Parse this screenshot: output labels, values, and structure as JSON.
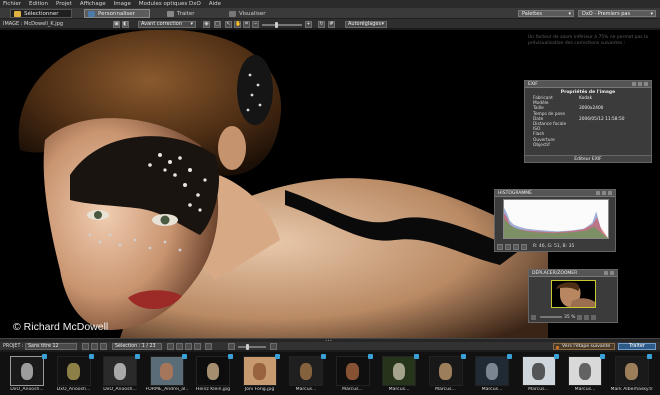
{
  "menu": [
    "Fichier",
    "Edition",
    "Projet",
    "Affichage",
    "Image",
    "Modules optiques DxO",
    "Aide"
  ],
  "workflow_tabs": [
    {
      "label": "Sélectionner",
      "active": false
    },
    {
      "label": "Personnaliser",
      "active": true
    },
    {
      "label": "Traiter",
      "active": false
    },
    {
      "label": "Visualiser",
      "active": false
    }
  ],
  "header": {
    "palette_label": "Palettes",
    "preset_label": "DxO - Premiers pas"
  },
  "image_toolbar": {
    "filename": "IMAGE : McDowell_K.jpg",
    "compare_label": "Avant correction",
    "auto_label": "Autoréglages"
  },
  "viewer": {
    "credit": "© Richard McDowell",
    "faded_note": "Un facteur de zoom inférieur à 75% ne permet pas la prévisualisation des corrections suivantes :"
  },
  "exif": {
    "title": "EXIF",
    "group": "Propriétés de l'image",
    "rows": [
      {
        "k": "Fabricant",
        "v": "Kodak"
      },
      {
        "k": "Modèle",
        "v": ""
      },
      {
        "k": "Taille",
        "v": "3000x2400"
      },
      {
        "k": "Temps de pose",
        "v": ""
      },
      {
        "k": "Date",
        "v": "2006/05/12 11:58:50"
      },
      {
        "k": "Distance focale",
        "v": ""
      },
      {
        "k": "ISO",
        "v": ""
      },
      {
        "k": "Flash",
        "v": ""
      },
      {
        "k": "Ouverture",
        "v": ""
      },
      {
        "k": "Objectif",
        "v": ""
      }
    ],
    "footer": "Editeur EXIF"
  },
  "histogram": {
    "title": "HISTOGRAMME",
    "readout": "R: 46, G: 51, B: 35"
  },
  "navigator": {
    "title": "DÉPLACER/ZOOMER",
    "zoom": "35 %"
  },
  "project_bar": {
    "project_label": "PROJET :",
    "project_name": "Sans titre 12",
    "selection": "Sélection : 1 / 23",
    "next_image": "Vers l'étape suivante",
    "process": "Traiter"
  },
  "divider_grip": "•••",
  "filmstrip": [
    {
      "caption": "DxO_Anoosh...",
      "tone": "#1a1a1a",
      "accent": "#c9c9c9"
    },
    {
      "caption": "DxO_Anoosh...",
      "tone": "#121212",
      "accent": "#b7a55a"
    },
    {
      "caption": "DxO_Anoosh...",
      "tone": "#2a2a2a",
      "accent": "#d4d4d4"
    },
    {
      "caption": "FORME_Andrei_al...",
      "tone": "#5a6c78",
      "accent": "#c07a50"
    },
    {
      "caption": "Heinz Klein.jpg",
      "tone": "#0d0d0d",
      "accent": "#d8b890"
    },
    {
      "caption": "Joni Fong.jpg",
      "tone": "#c89a70",
      "accent": "#8a5030"
    },
    {
      "caption": "Marcus...",
      "tone": "#1f1f1f",
      "accent": "#a87a48"
    },
    {
      "caption": "Marcus...",
      "tone": "#0f0f0f",
      "accent": "#b06a40"
    },
    {
      "caption": "Marcus...",
      "tone": "#26341c",
      "accent": "#d0c8b0"
    },
    {
      "caption": "Marcus...",
      "tone": "#181818",
      "accent": "#c8a070"
    },
    {
      "caption": "Marcus...",
      "tone": "#202a34",
      "accent": "#9aa4b0"
    },
    {
      "caption": "Marcus...",
      "tone": "#cfd6dc",
      "accent": "#2a2a2a"
    },
    {
      "caption": "Marcus...",
      "tone": "#d9d9d9",
      "accent": "#3a3a3a"
    },
    {
      "caption": "Mark Alberhasky.tif",
      "tone": "#1a1a1a",
      "accent": "#c9a070"
    }
  ],
  "colors": {
    "accent_blue": "#3aa0d8",
    "process_blue": "#2d5a86",
    "next_orange": "#e07a20",
    "nav_frame": "#c9c931"
  }
}
